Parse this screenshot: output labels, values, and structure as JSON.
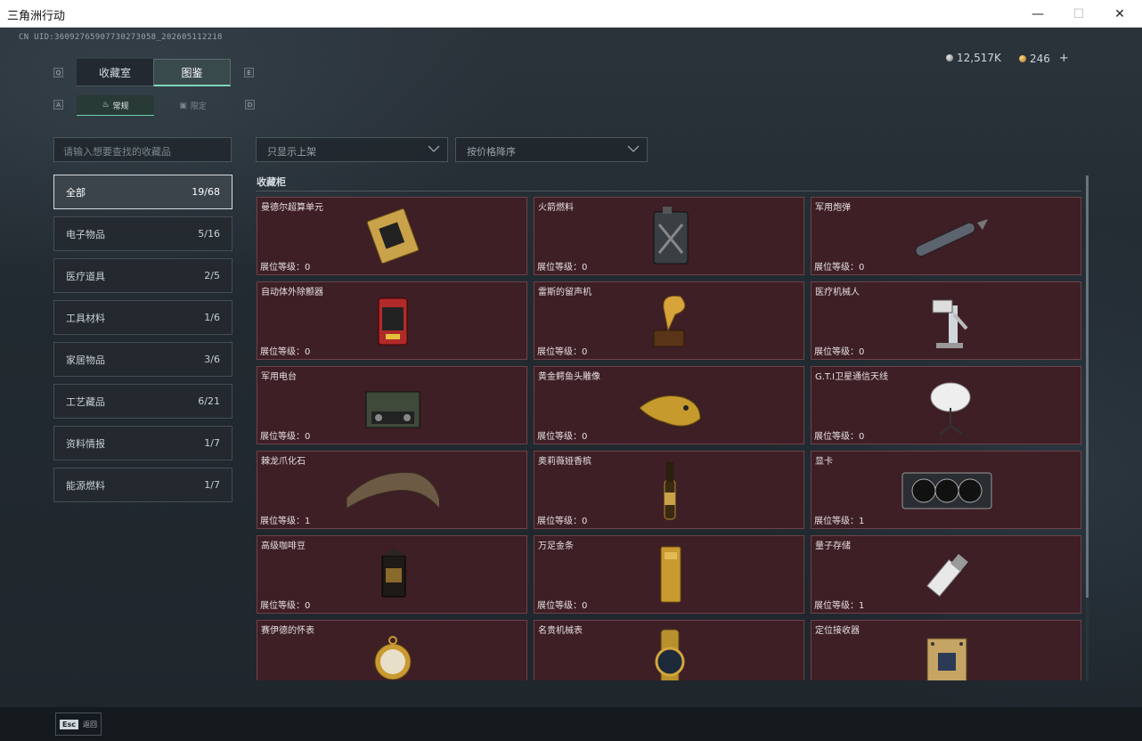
{
  "window": {
    "title": "三角洲行动",
    "min": "—",
    "max": "☐",
    "close": "✕"
  },
  "header": {
    "uid": "CN UID:36092765907730273058_202605112218",
    "currency": [
      {
        "value": "12,517K"
      },
      {
        "value": "246"
      }
    ],
    "plus": "+"
  },
  "tabs": [
    {
      "label": "收藏室"
    },
    {
      "label": "图鉴"
    }
  ],
  "tab_keys": {
    "left": "Q",
    "right": "E"
  },
  "subtabs": [
    {
      "label": "常规"
    },
    {
      "label": "限定"
    }
  ],
  "subtab_keys": {
    "left": "A",
    "right": "D"
  },
  "search": {
    "placeholder": "请输入想要查找的收藏品"
  },
  "filters": [
    {
      "value": "只显示上架"
    },
    {
      "value": "按价格降序"
    }
  ],
  "categories": [
    {
      "label": "全部",
      "count": "19/68"
    },
    {
      "label": "电子物品",
      "count": "5/16"
    },
    {
      "label": "医疗道具",
      "count": "2/5"
    },
    {
      "label": "工具材料",
      "count": "1/6"
    },
    {
      "label": "家居物品",
      "count": "3/6"
    },
    {
      "label": "工艺藏品",
      "count": "6/21"
    },
    {
      "label": "资料情报",
      "count": "1/7"
    },
    {
      "label": "能源燃料",
      "count": "1/7"
    }
  ],
  "section_title": "收藏柜",
  "level_prefix": "展位等级：",
  "items": [
    {
      "name": "曼德尔超算单元",
      "level": "0",
      "icon": "chip-icon"
    },
    {
      "name": "火箭燃料",
      "level": "0",
      "icon": "fuel-can-icon"
    },
    {
      "name": "军用炮弹",
      "level": "0",
      "icon": "shell-icon"
    },
    {
      "name": "自动体外除颤器",
      "level": "0",
      "icon": "defibrillator-icon"
    },
    {
      "name": "雷斯的留声机",
      "level": "0",
      "icon": "gramophone-icon"
    },
    {
      "name": "医疗机械人",
      "level": "0",
      "icon": "medical-robot-icon"
    },
    {
      "name": "军用电台",
      "level": "0",
      "icon": "radio-icon"
    },
    {
      "name": "黄金鳄鱼头雕像",
      "level": "0",
      "icon": "gold-croc-icon"
    },
    {
      "name": "G.T.I卫星通信天线",
      "level": "0",
      "icon": "satellite-dish-icon"
    },
    {
      "name": "棘龙爪化石",
      "level": "1",
      "icon": "claw-fossil-icon"
    },
    {
      "name": "奥莉薇娅香槟",
      "level": "0",
      "icon": "champagne-icon"
    },
    {
      "name": "显卡",
      "level": "1",
      "icon": "gpu-icon"
    },
    {
      "name": "高级咖啡豆",
      "level": "0",
      "icon": "coffee-bag-icon"
    },
    {
      "name": "万足金条",
      "level": "0",
      "icon": "gold-bar-icon"
    },
    {
      "name": "量子存储",
      "level": "1",
      "icon": "usb-drive-icon"
    },
    {
      "name": "赛伊德的怀表",
      "level": "",
      "icon": "pocket-watch-icon"
    },
    {
      "name": "名贵机械表",
      "level": "",
      "icon": "wristwatch-icon"
    },
    {
      "name": "定位接收器",
      "level": "",
      "icon": "receiver-board-icon"
    }
  ],
  "footer": {
    "key": "Esc",
    "label": "返回"
  }
}
